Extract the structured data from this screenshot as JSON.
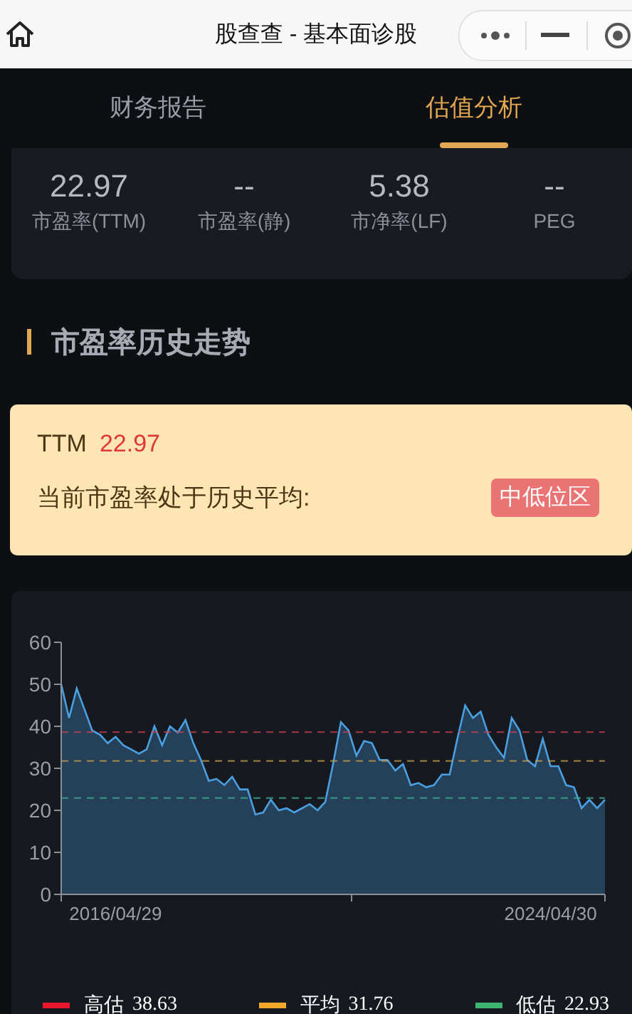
{
  "header": {
    "title": "股查查 - 基本面诊股"
  },
  "tabs": [
    {
      "label": "财务报告",
      "selected": false
    },
    {
      "label": "估值分析",
      "selected": true
    }
  ],
  "metrics": [
    {
      "value": "22.97",
      "label": "市盈率(TTM)"
    },
    {
      "value": "--",
      "label": "市盈率(静)"
    },
    {
      "value": "5.38",
      "label": "市净率(LF)"
    },
    {
      "value": "--",
      "label": "PEG"
    }
  ],
  "section_title": "市盈率历史走势",
  "status": {
    "label": "TTM",
    "value": "22.97",
    "text": "当前市盈率处于历史平均:",
    "badge": "中低位区"
  },
  "chart": {
    "chart_data": {
      "type": "area",
      "ylim": [
        0,
        60
      ],
      "yticks": [
        0,
        10,
        20,
        30,
        40,
        50,
        60
      ],
      "categories": [
        null,
        null,
        null,
        null,
        null,
        null,
        null,
        "2016/04/29",
        null,
        null,
        null,
        null,
        null,
        null,
        null,
        null,
        null,
        null,
        null,
        null,
        null,
        null,
        null,
        null,
        null,
        null,
        null,
        null,
        null,
        null,
        null,
        null,
        null,
        null,
        null,
        null,
        null,
        null,
        null,
        null,
        null,
        null,
        null,
        null,
        null,
        null,
        null,
        null,
        null,
        null,
        null,
        null,
        null,
        null,
        null,
        null,
        null,
        null,
        null,
        null,
        null,
        null,
        null,
        "2024/04/30",
        null,
        null,
        null,
        null,
        null,
        null,
        null
      ],
      "series": [
        {
          "color": "#4a9fe0",
          "values": [
            50,
            42,
            49,
            44,
            39,
            38,
            36,
            37.5,
            35.5,
            34.5,
            33.5,
            34.5,
            40,
            35.5,
            40,
            38.5,
            41.5,
            36,
            32,
            27,
            27.5,
            26,
            28,
            25,
            25,
            19,
            19.5,
            22.5,
            20,
            20.5,
            19.5,
            20.5,
            21.5,
            20,
            22,
            31,
            41,
            39,
            33,
            36.5,
            36,
            32,
            32,
            29.5,
            31,
            26,
            26.5,
            25.5,
            26,
            28.5,
            28.5,
            37,
            45,
            42,
            43.5,
            38,
            35,
            32.5,
            42,
            39,
            32,
            30.5,
            37,
            30.5,
            30.5,
            26,
            25.5,
            20.5,
            22.5,
            20.5,
            22.5
          ]
        }
      ],
      "ref_lines": [
        {
          "axis": "y",
          "value": 38.63,
          "color": "#c8414f"
        },
        {
          "axis": "y",
          "value": 31.76,
          "color": "#c9a247"
        },
        {
          "axis": "y",
          "value": 22.93,
          "color": "#3aa88c"
        }
      ]
    },
    "legend": [
      {
        "label": "高估",
        "value": "38.63",
        "color": "#e8152b"
      },
      {
        "label": "平均",
        "value": "31.76",
        "color": "#f0a92b"
      },
      {
        "label": "低估",
        "value": "22.93",
        "color": "#3cb371"
      }
    ]
  }
}
